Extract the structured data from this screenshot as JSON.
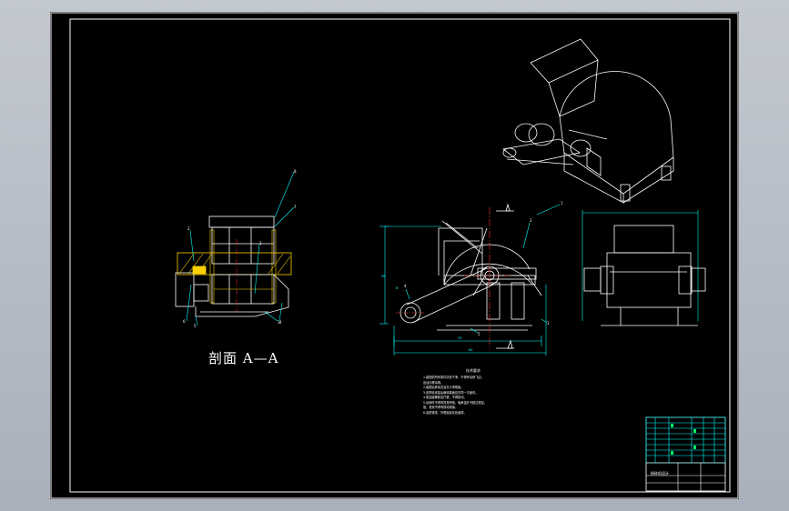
{
  "drawing": {
    "section_label": "剖面 A—A",
    "colors": {
      "background": "#000000",
      "outline": "#ffffff",
      "dimension": "#00ffff",
      "centerline": "#ff3030",
      "hatch": "#ffd000",
      "border": "#ffffff"
    }
  },
  "left_view": {
    "callouts": [
      "8",
      "7",
      "2",
      "1",
      "3",
      "4",
      "5",
      "6"
    ]
  },
  "front_view": {
    "callouts": [
      "1",
      "2",
      "3",
      "4",
      "5"
    ],
    "dim_labels": [
      "36",
      "25",
      "84",
      "B"
    ]
  },
  "tech_notes": {
    "title": "技术要求",
    "lines": [
      "1.装配前所有零件清洗干净，不得有毛刺飞边。",
      "  及油污等杂物。",
      "2.装配后转动灵活无卡滞现象。",
      "3.皮带轮安装后两轮端面应在同一平面内。",
      "4.各连接螺栓应拧紧，不得松动。",
      "5.运转时不得有异常声音，轴承温升不超过规定。",
      "  值，机壳不得有振动现象。",
      "6.涂防锈漆，外表面涂灰色面漆。"
    ]
  },
  "title_block": {
    "designer_cell": "粉碎机设计"
  }
}
